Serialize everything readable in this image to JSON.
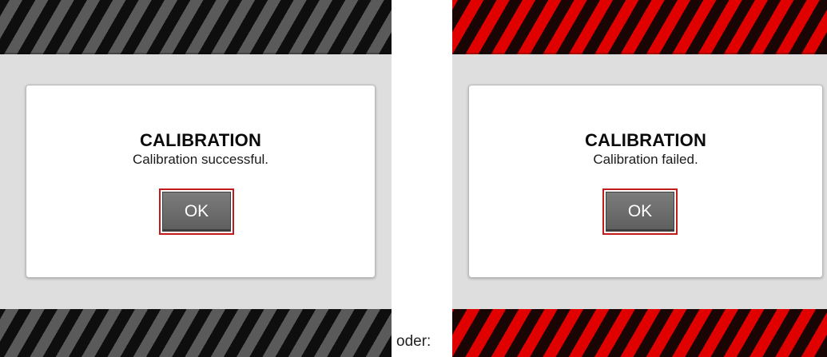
{
  "colors": {
    "stripe_gray_dark": "#0e0e0e",
    "stripe_gray_light": "#5a5a5a",
    "stripe_red_dark": "#1a0505",
    "stripe_red_light": "#e00000",
    "button_border": "#c21b1b",
    "button_fill": "#6e6e6e",
    "screen_background": "#dedede"
  },
  "screens": [
    {
      "status": "success",
      "stripe_icon": "warning-stripes-gray",
      "dialog": {
        "title": "CALIBRATION",
        "message": "Calibration successful.",
        "button_label": "OK"
      }
    },
    {
      "status": "failed",
      "stripe_icon": "warning-stripes-red",
      "dialog": {
        "title": "CALIBRATION",
        "message": "Calibration failed.",
        "button_label": "OK"
      }
    }
  ],
  "separator_text": "oder:"
}
